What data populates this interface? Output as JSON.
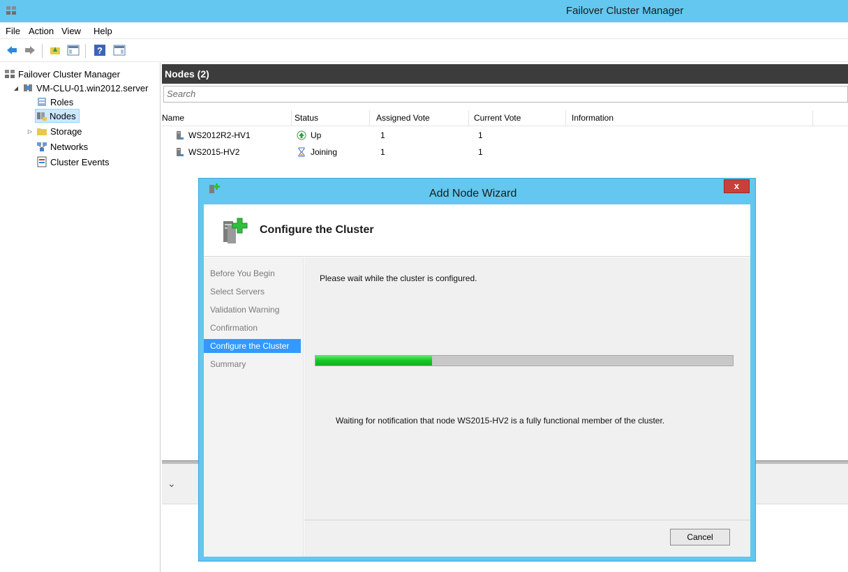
{
  "window": {
    "title": "Failover Cluster Manager"
  },
  "menu": [
    "File",
    "Action",
    "View",
    "Help"
  ],
  "tree": {
    "root": "Failover Cluster Manager",
    "cluster": "VM-CLU-01.win2012.server",
    "items": [
      "Roles",
      "Nodes",
      "Storage",
      "Networks",
      "Cluster Events"
    ]
  },
  "nodes_pane": {
    "header": "Nodes (2)",
    "search_placeholder": "Search",
    "columns": [
      "Name",
      "Status",
      "Assigned Vote",
      "Current Vote",
      "Information"
    ],
    "rows": [
      {
        "name": "WS2012R2-HV1",
        "status": "Up",
        "assigned_vote": "1",
        "current_vote": "1"
      },
      {
        "name": "WS2015-HV2",
        "status": "Joining",
        "assigned_vote": "1",
        "current_vote": "1"
      }
    ]
  },
  "wizard": {
    "title": "Add Node Wizard",
    "heading": "Configure the Cluster",
    "steps": [
      "Before You Begin",
      "Select Servers",
      "Validation Warning",
      "Confirmation",
      "Configure the Cluster",
      "Summary"
    ],
    "active_step": "Configure the Cluster",
    "message": "Please wait while the cluster is configured.",
    "progress_fraction": 0.28,
    "waiting_message": "Waiting for notification that node WS2015-HV2 is a fully functional member of the cluster.",
    "cancel_label": "Cancel"
  },
  "colors": {
    "title_bar": "#63c7ef",
    "pane_header": "#3c3c3c",
    "active_step": "#3399ff",
    "progress_fill": "#12c722"
  }
}
